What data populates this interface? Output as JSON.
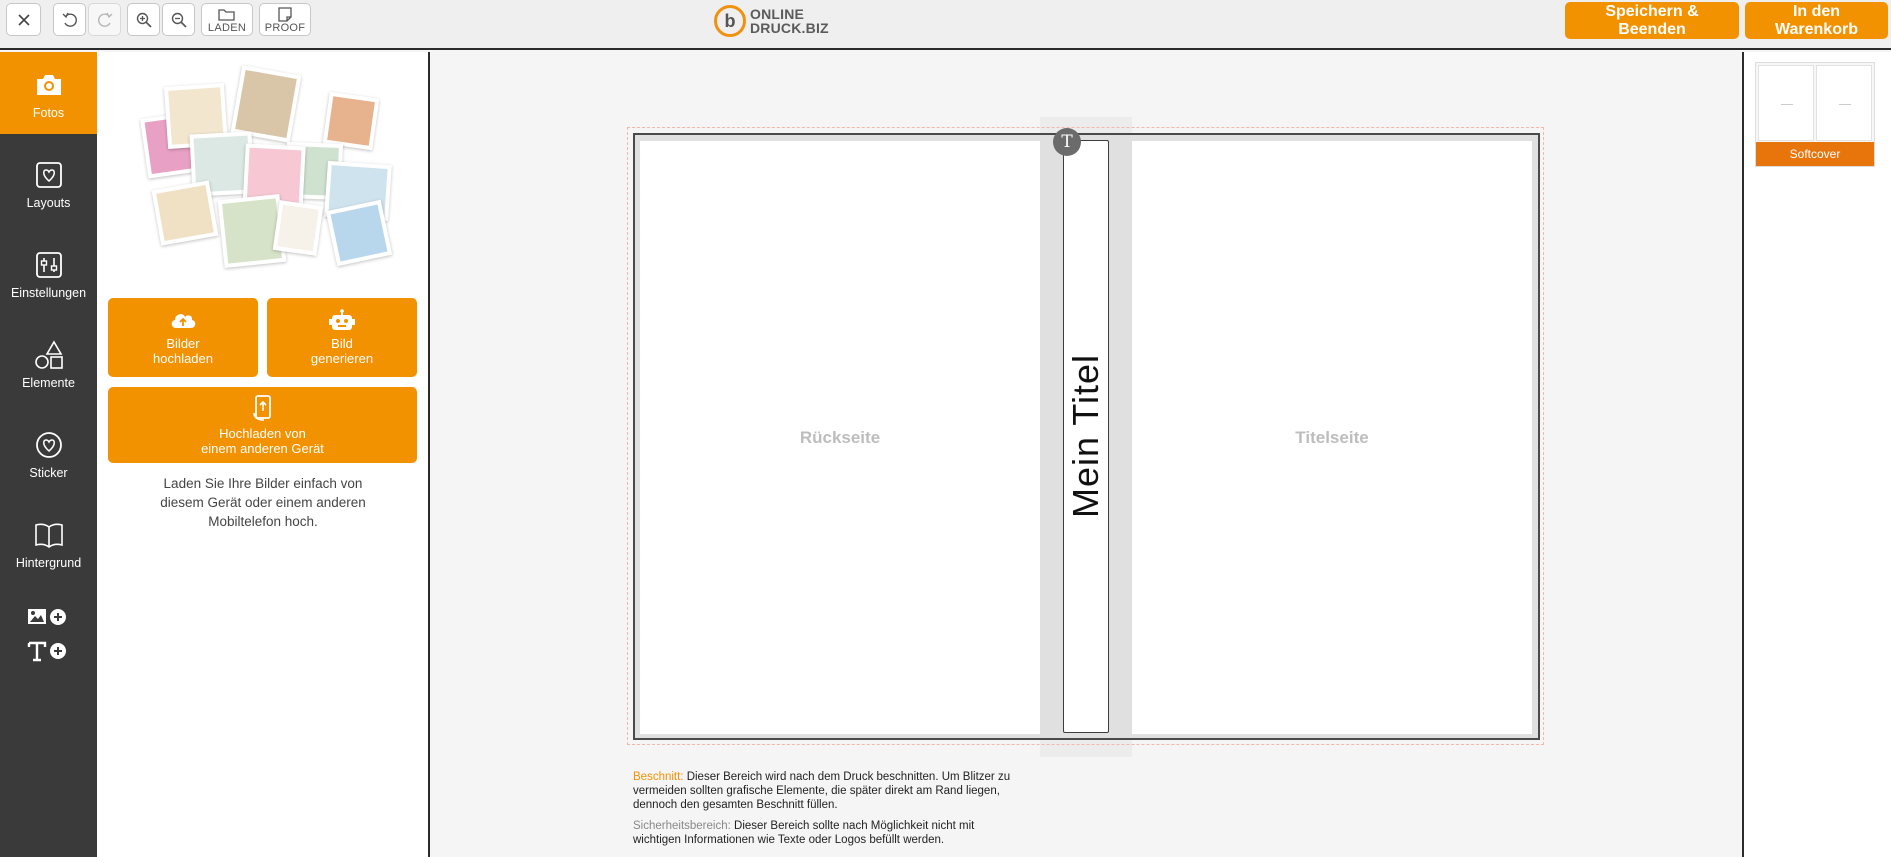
{
  "toolbar": {
    "close_icon": "close-icon",
    "undo_icon": "undo-icon",
    "redo_icon": "redo-icon",
    "zoom_in_icon": "zoom-in-icon",
    "zoom_out_icon": "zoom-out-icon",
    "load_label": "LADEN",
    "proof_label": "PROOF",
    "logo_line1": "ONLINE",
    "logo_line2": "DRUCK.BIZ",
    "save_label": "Speichern & Beenden",
    "cart_label": "In den Warenkorb",
    "accent_color": "#f39200"
  },
  "sidebar": {
    "items": [
      {
        "label": "Fotos",
        "icon": "camera-icon",
        "active": true
      },
      {
        "label": "Layouts",
        "icon": "layout-icon"
      },
      {
        "label": "Einstellungen",
        "icon": "settings-icon"
      },
      {
        "label": "Elemente",
        "icon": "shapes-icon"
      },
      {
        "label": "Sticker",
        "icon": "sticker-icon"
      },
      {
        "label": "Hintergrund",
        "icon": "book-icon"
      }
    ],
    "add_image_icon": "add-image-icon",
    "add_text_icon": "add-text-icon"
  },
  "panel": {
    "upload_label_1": "Bilder",
    "upload_label_2": "hochladen",
    "generate_label_1": "Bild",
    "generate_label_2": "generieren",
    "other_device_label_1": "Hochladen von",
    "other_device_label_2": "einem anderen Gerät",
    "desc_1": "Laden Sie Ihre Bilder einfach von",
    "desc_2": "diesem Gerät oder einem anderen",
    "desc_3": "Mobiltelefon hoch."
  },
  "canvas": {
    "back_label": "Rückseite",
    "front_label": "Titelseite",
    "spine_title": "Mein Titel",
    "text_handle": "T",
    "note1_key": "Beschnitt:",
    "note1_text_1": " Dieser Bereich wird nach dem Druck beschnitten. Um Blitzer zu",
    "note1_text_2": "vermeiden sollten grafische Elemente, die später direkt am Rand liegen,",
    "note1_text_3": "dennoch den gesamten Beschnitt füllen.",
    "note2_key": "Sicherheitsbereich:",
    "note2_text_1": " Dieser Bereich sollte nach Möglichkeit nicht mit",
    "note2_text_2": "wichtigen Informationen wie Texte oder Logos befüllt werden."
  },
  "pages_panel": {
    "thumb_caption": "Softcover"
  }
}
